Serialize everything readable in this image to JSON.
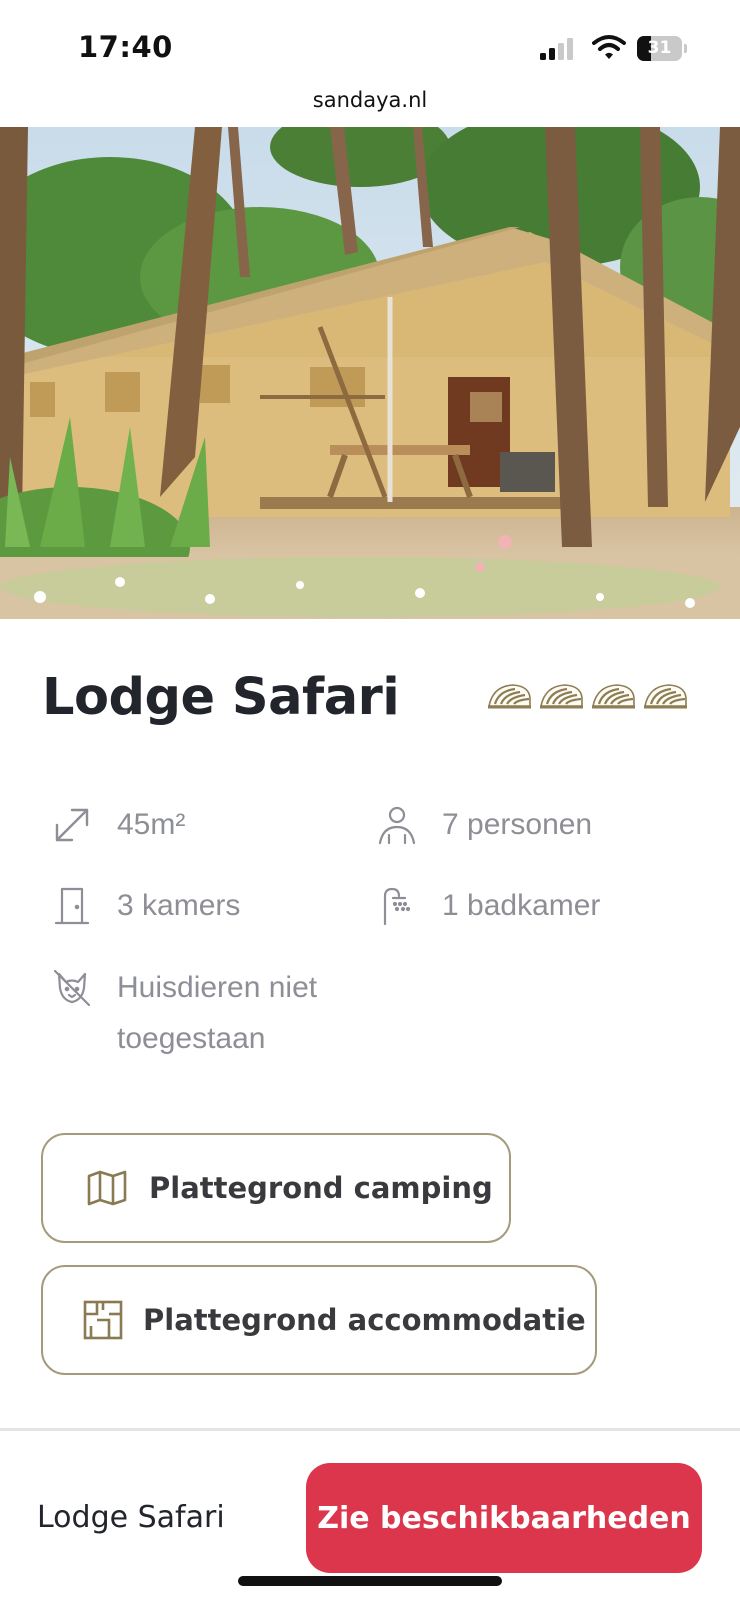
{
  "status": {
    "time": "17:40",
    "battery_percent": "31",
    "battery_level": 0.31
  },
  "browser": {
    "url": "sandaya.nl"
  },
  "hero": {
    "image_alt": "Lodge Safari tent"
  },
  "accommodation": {
    "name": "Lodge Safari",
    "rating_count": 4,
    "rating_icon": "shell-icon",
    "features": {
      "size": {
        "icon": "resize-arrow-icon",
        "text": "45m²"
      },
      "persons": {
        "icon": "person-icon",
        "text": "7 personen"
      },
      "rooms": {
        "icon": "door-icon",
        "text": "3 kamers"
      },
      "bathroom": {
        "icon": "shower-icon",
        "text": "1 badkamer"
      },
      "pets": {
        "icon": "no-pets-icon",
        "text": "Huisdieren niet toegestaan"
      }
    }
  },
  "buttons": {
    "camping_map": {
      "label": "Plattegrond camping",
      "icon": "map-icon"
    },
    "accommodation_plan": {
      "label": "Plattegrond accommodatie",
      "icon": "floorplan-icon"
    }
  },
  "bottom_bar": {
    "title": "Lodge Safari",
    "cta_label": "Zie beschikbaarheden"
  },
  "colors": {
    "accent_gold": "#a49b7c",
    "cta_red": "#dc364c",
    "feature_gray": "#8d8e96"
  }
}
